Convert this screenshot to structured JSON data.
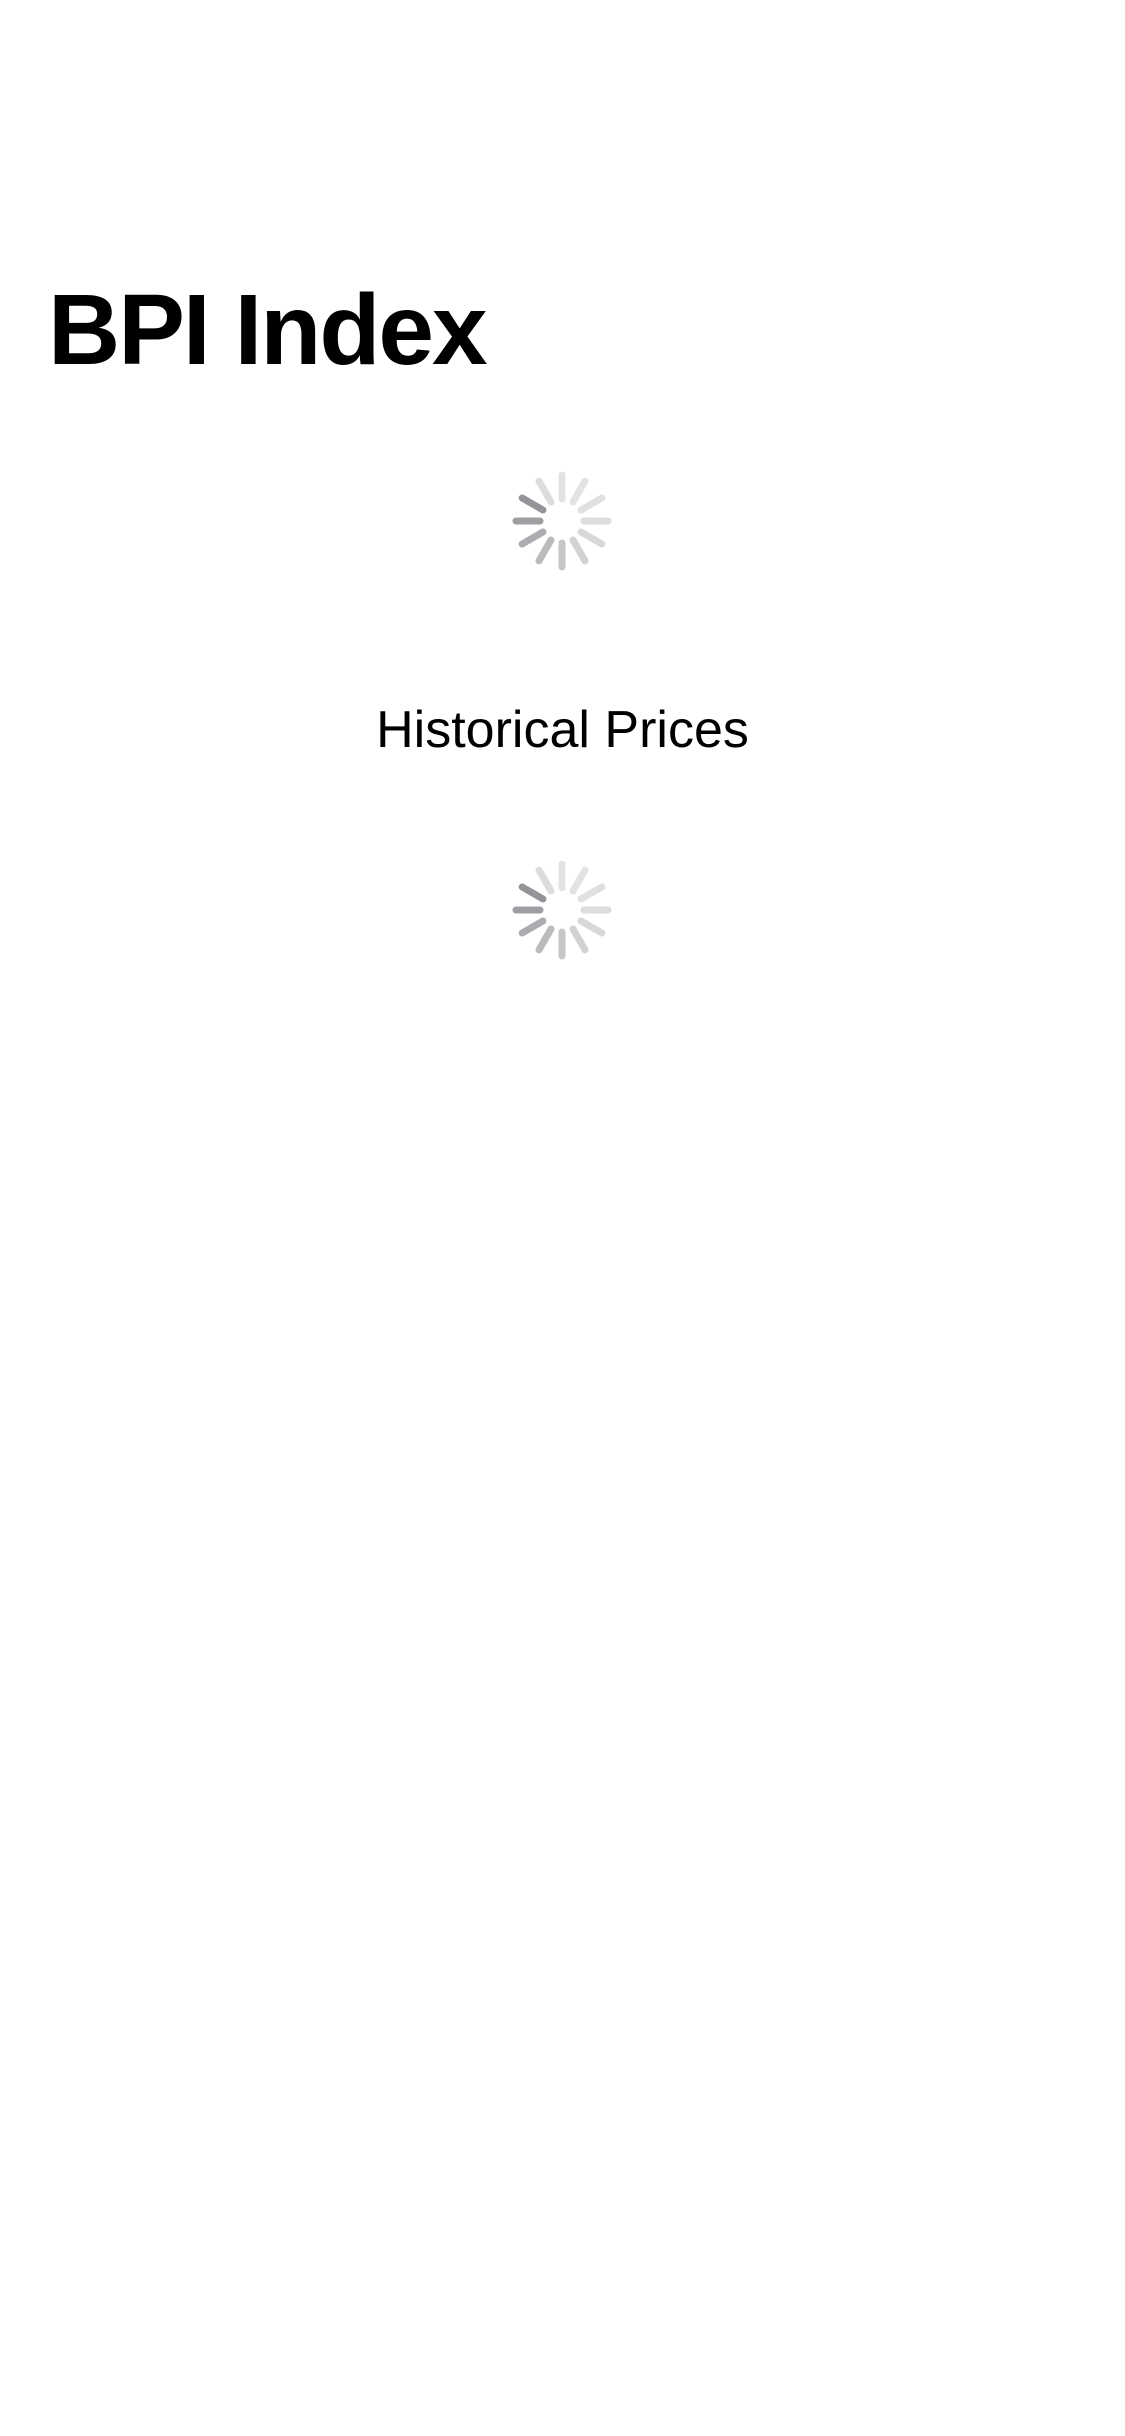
{
  "navigation": {
    "title": "BPI Index"
  },
  "current_price": {
    "state": "loading",
    "indicator_icon": "activity-indicator-icon"
  },
  "historical_prices": {
    "heading": "Historical Prices",
    "state": "loading",
    "indicator_icon": "activity-indicator-icon"
  },
  "colors": {
    "background": "#ffffff",
    "text": "#000000",
    "spinner": "#8e8e93"
  }
}
